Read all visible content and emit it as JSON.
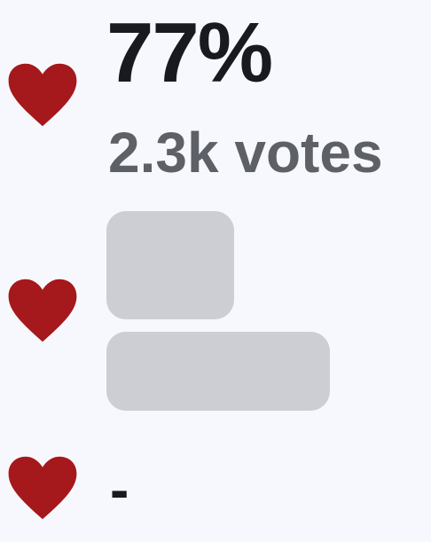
{
  "rating": {
    "score": "77%",
    "votes": "2.3k votes",
    "empty_value": "-"
  },
  "icons": {
    "row1": "heart-icon",
    "row2": "heart-icon",
    "row3": "heart-icon"
  },
  "colors": {
    "background": "#f7f8fd",
    "heart": "#a5181b",
    "score_text": "#181a1f",
    "votes_text": "#5d6066",
    "skeleton": "#ccced4"
  }
}
